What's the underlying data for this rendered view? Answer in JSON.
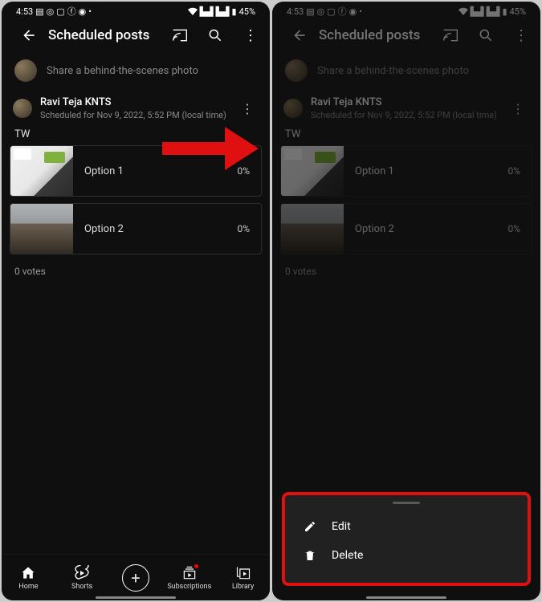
{
  "status": {
    "time": "4:53",
    "battery": "45%"
  },
  "appbar": {
    "title": "Scheduled posts"
  },
  "share": {
    "prompt": "Share a behind-the-scenes photo"
  },
  "post": {
    "author": "Ravi Teja KNTS",
    "meta": "Scheduled for Nov 9, 2022, 5:52 PM (local time)",
    "label": "TW",
    "poll": {
      "options": [
        {
          "label": "Option 1",
          "pct": "0%"
        },
        {
          "label": "Option 2",
          "pct": "0%"
        }
      ],
      "votes": "0 votes"
    }
  },
  "sheet": {
    "edit": "Edit",
    "delete": "Delete"
  },
  "nav": {
    "home": "Home",
    "shorts": "Shorts",
    "subs": "Subscriptions",
    "library": "Library"
  }
}
